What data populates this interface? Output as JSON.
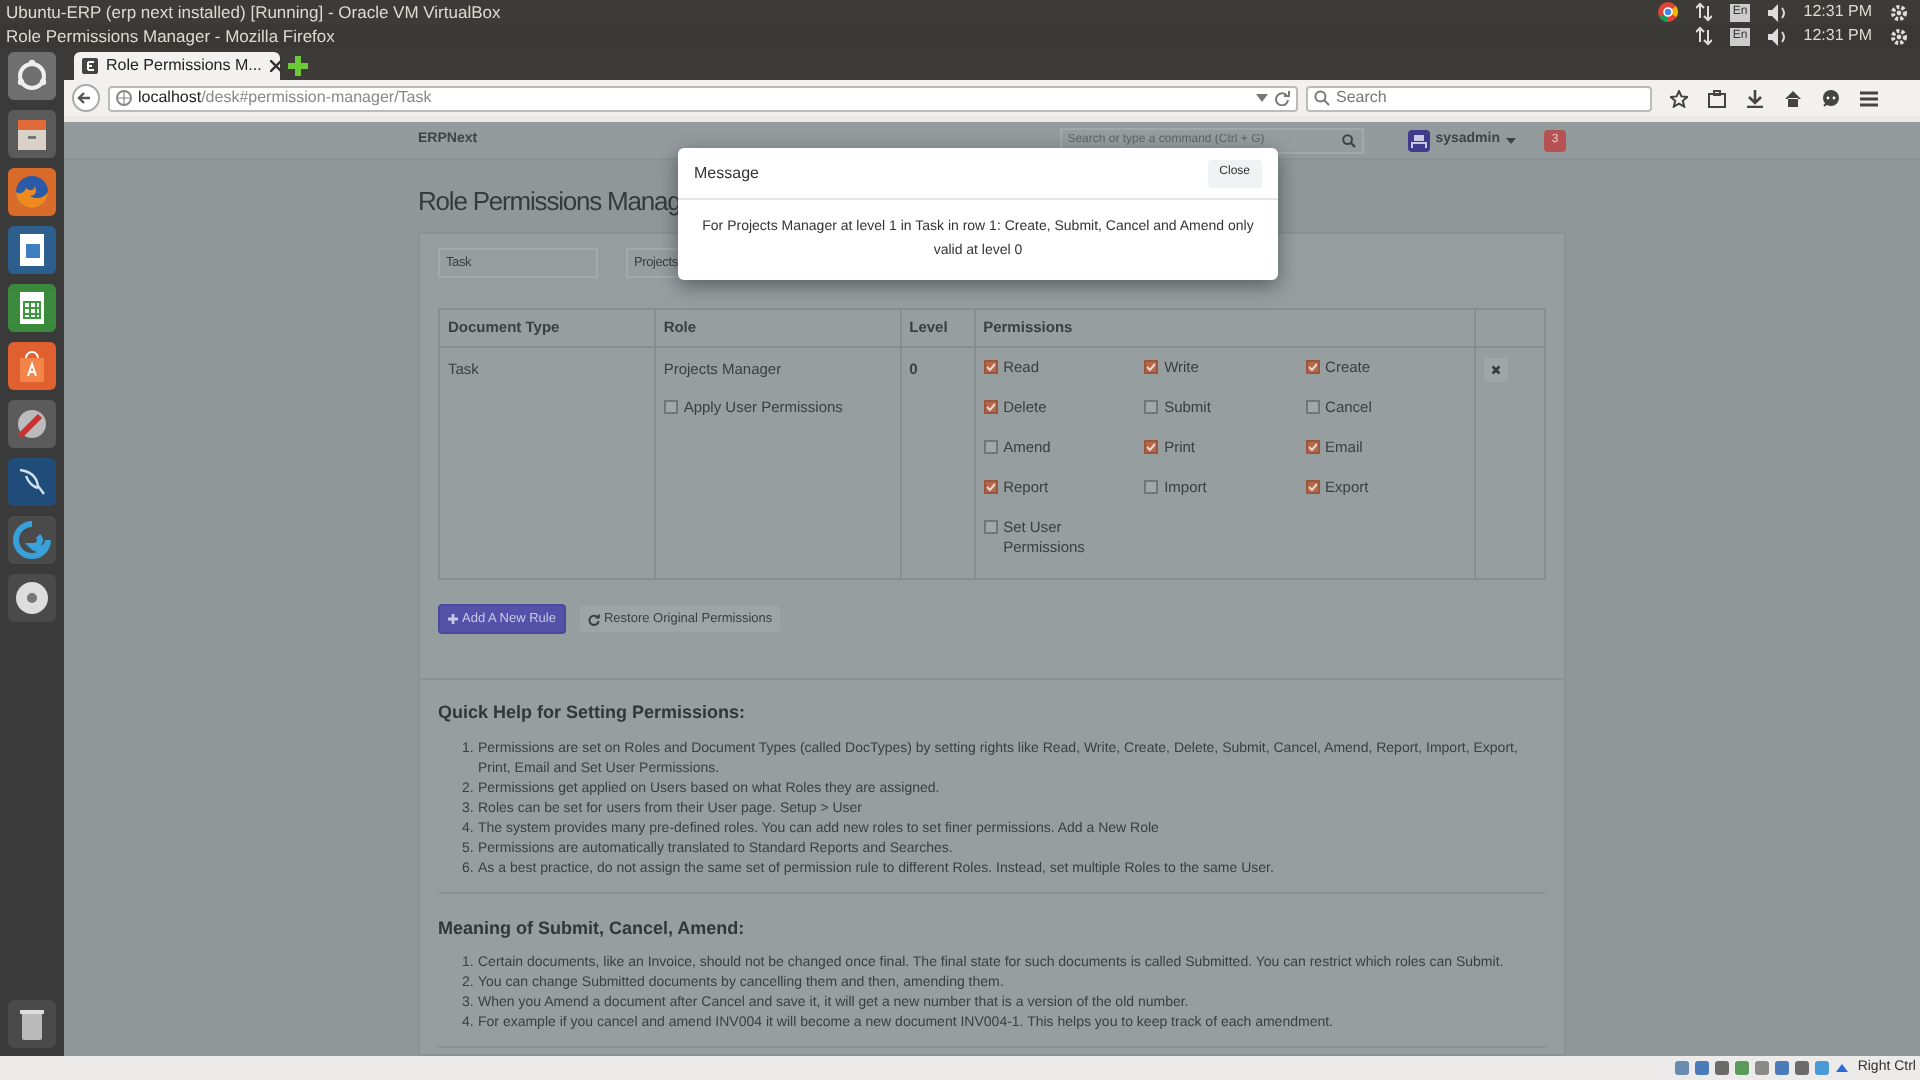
{
  "vm_title": "Ubuntu-ERP (erp next installed) [Running] - Oracle VM VirtualBox",
  "window_title": "Role Permissions Manager - Mozilla Firefox",
  "top_panels": [
    {
      "keyboard": "En",
      "clock": "12:31 PM",
      "browser_icon": true
    },
    {
      "keyboard": "En",
      "clock": "12:31 PM",
      "browser_icon": false
    }
  ],
  "browser": {
    "tab": {
      "title": "Role Permissions M...",
      "selected": true
    },
    "url_host": "localhost",
    "url_path": "/desk#permission-manager/Task",
    "search": {
      "placeholder": "Search"
    }
  },
  "app": {
    "brand": "ERPNext",
    "search": {
      "placeholder": "Search or type a command (Ctrl + G)"
    },
    "user": "sysadmin",
    "notifications": "3"
  },
  "page_title": "Role Permissions Manag",
  "filters": [
    {
      "value": "Task"
    },
    {
      "value": "Projects"
    }
  ],
  "table": {
    "columns": [
      "Document Type",
      "Role",
      "Level",
      "Permissions"
    ],
    "rows": [
      {
        "document_type": "Task",
        "role": "Projects Manager",
        "apply_user_permissions": {
          "label": "Apply User Permissions",
          "checked": false
        },
        "level": "0",
        "permissions": [
          {
            "label": "Read",
            "checked": true
          },
          {
            "label": "Write",
            "checked": true
          },
          {
            "label": "Create",
            "checked": true
          },
          {
            "label": "Delete",
            "checked": true
          },
          {
            "label": "Submit",
            "checked": false
          },
          {
            "label": "Cancel",
            "checked": false
          },
          {
            "label": "Amend",
            "checked": false
          },
          {
            "label": "Print",
            "checked": true
          },
          {
            "label": "Email",
            "checked": true
          },
          {
            "label": "Report",
            "checked": true
          },
          {
            "label": "Import",
            "checked": false
          },
          {
            "label": "Export",
            "checked": true
          },
          {
            "label": "Set User Permissions",
            "checked": false
          }
        ]
      }
    ]
  },
  "buttons": [
    {
      "label": "Add A New Rule",
      "kind": "primary"
    },
    {
      "label": "Restore Original Permissions",
      "kind": "default"
    }
  ],
  "help_sections": [
    {
      "title": "Quick Help for Setting Permissions:",
      "items": [
        {
          "number": "1.",
          "text": "Permissions are set on Roles and Document Types (called DocTypes) by setting rights like Read, Write, Create, Delete, Submit, Cancel, Amend, Report, Import, Export, Print, Email and Set User Permissions."
        },
        {
          "number": "2.",
          "text": "Permissions get applied on Users based on what Roles they are assigned."
        },
        {
          "number": "3.",
          "text": "Roles can be set for users from their User page. Setup > User"
        },
        {
          "number": "4.",
          "text": "The system provides many pre-defined roles. You can add new roles to set finer permissions. Add a New Role"
        },
        {
          "number": "5.",
          "text": "Permissions are automatically translated to Standard Reports and Searches."
        },
        {
          "number": "6.",
          "text": "As a best practice, do not assign the same set of permission rule to different Roles. Instead, set multiple Roles to the same User."
        }
      ]
    },
    {
      "title": "Meaning of Submit, Cancel, Amend:",
      "items": [
        {
          "number": "1.",
          "text": "Certain documents, like an Invoice, should not be changed once final. The final state for such documents is called Submitted. You can restrict which roles can Submit."
        },
        {
          "number": "2.",
          "text": "You can change Submitted documents by cancelling them and then, amending them."
        },
        {
          "number": "3.",
          "text": "When you Amend a document after Cancel and save it, it will get a new number that is a version of the old number."
        },
        {
          "number": "4.",
          "text": "For example if you cancel and amend INV004 it will become a new document INV004-1. This helps you to keep track of each amendment."
        }
      ]
    }
  ],
  "dialog": {
    "title": "Message",
    "close": "Close",
    "message": "For Projects Manager at level 1 in Task in row 1: Create, Submit, Cancel and Amend only valid at level 0"
  },
  "status_bar": {
    "host_key": "Right Ctrl"
  }
}
